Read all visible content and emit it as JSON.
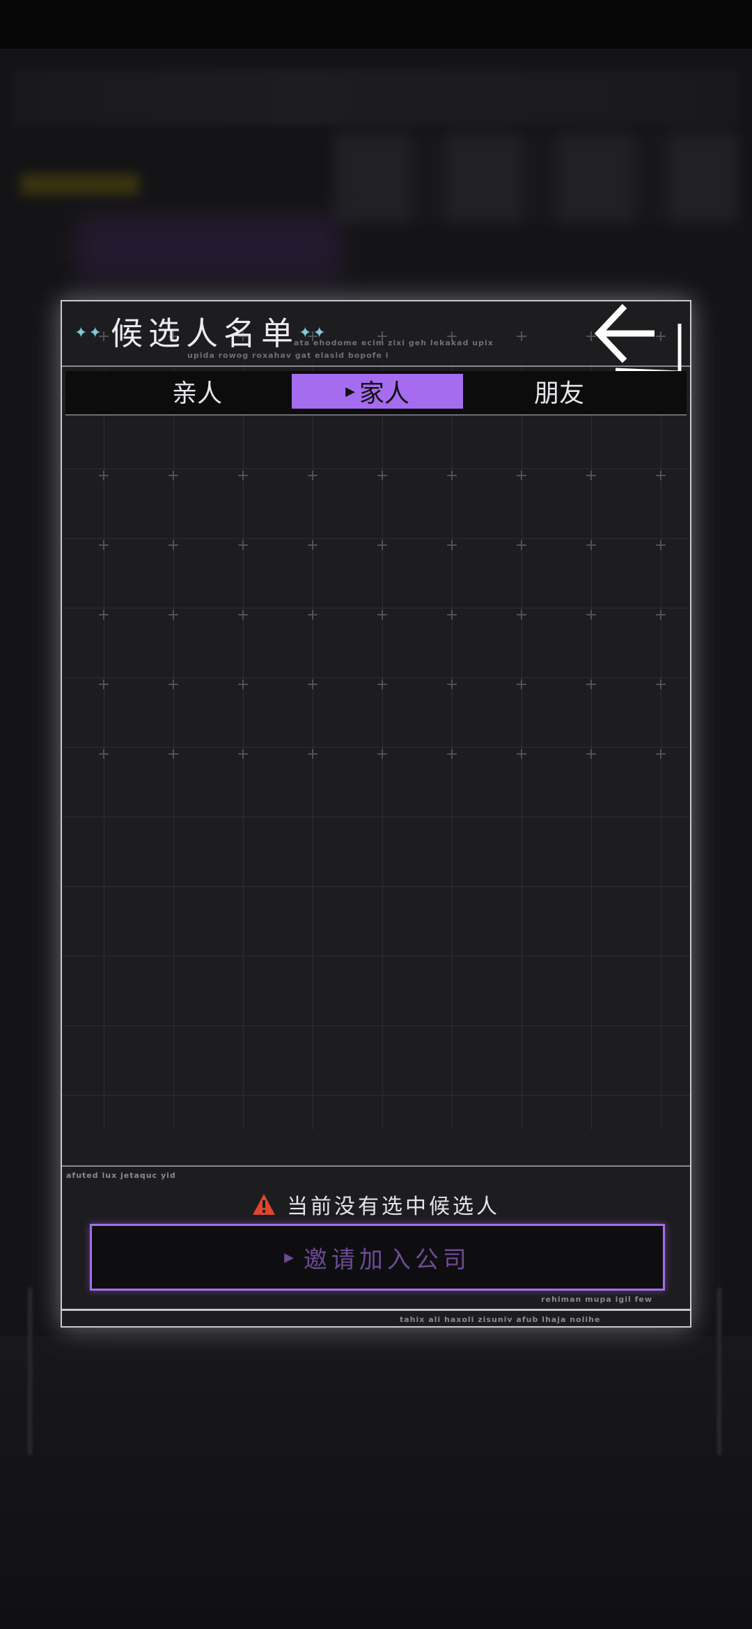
{
  "dialog": {
    "title": "候选人名单",
    "title_stars_left": "✦✦",
    "title_stars_right": "✦✦",
    "title_caption_1": "ata ehodome ecim zixi geh lekakad upix",
    "title_caption_2": "upida rowog roxahav gat elasid bopofe i"
  },
  "tabs": [
    {
      "label": "亲人",
      "active": false
    },
    {
      "label": "家人",
      "active": true
    },
    {
      "label": "朋友",
      "active": false
    }
  ],
  "footer": {
    "section_tag": "afuted lux jetaquc yid",
    "status_text": "当前没有选中候选人",
    "invite_label": "邀请加入公司",
    "invite_tag": "rehiman mupa igil few",
    "bottom_tag": "tahix ali haxoli zisuniv afub lhaja nolihe"
  },
  "colors": {
    "accent": "#a66cf0",
    "warning": "#e0452f",
    "star": "#7ec8d8"
  }
}
